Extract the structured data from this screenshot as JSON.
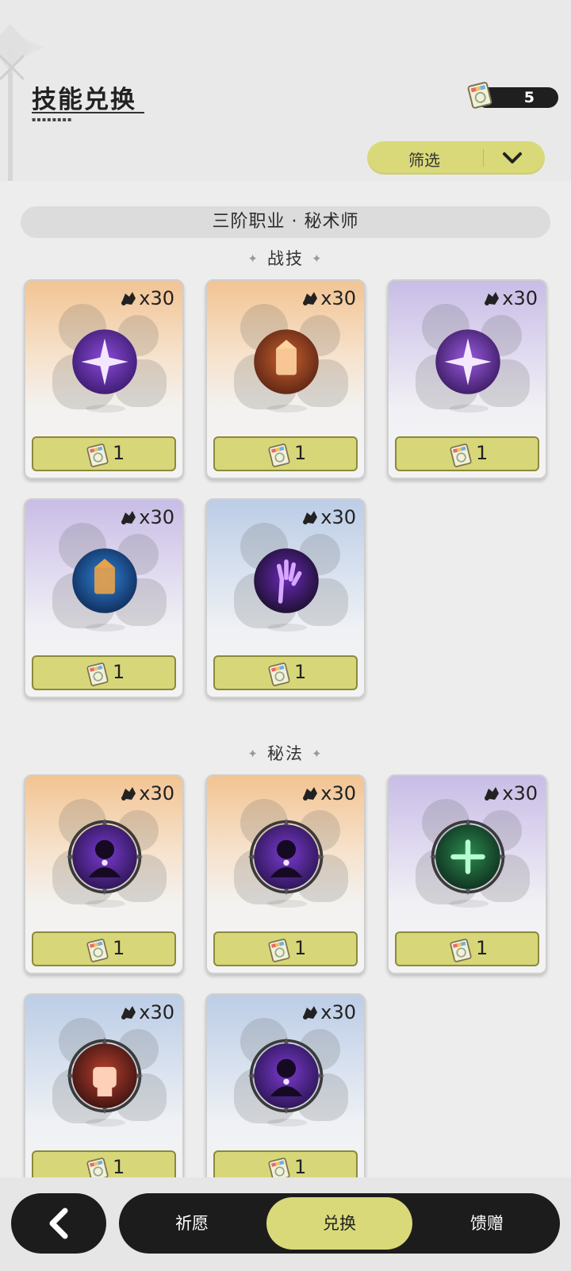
{
  "header": {
    "title": "技能兑换",
    "currency_value": "5",
    "filter_label": "筛选"
  },
  "class_name": "三阶职业 · 秘术师",
  "sections": [
    {
      "title": "战技",
      "cards": [
        {
          "theme": "orange",
          "icon": "purple-star-burst-skill-icon",
          "count": "x30",
          "cost": "1"
        },
        {
          "theme": "orange",
          "icon": "orange-totem-skill-icon",
          "count": "x30",
          "cost": "1"
        },
        {
          "theme": "purple",
          "icon": "violet-shatter-skill-icon",
          "count": "x30",
          "cost": "1"
        },
        {
          "theme": "purple",
          "icon": "blue-flame-totem-skill-icon",
          "count": "x30",
          "cost": "1"
        },
        {
          "theme": "blue",
          "icon": "shadow-hand-skill-icon",
          "count": "x30",
          "cost": "1"
        }
      ]
    },
    {
      "title": "秘法",
      "cards": [
        {
          "theme": "orange",
          "icon": "eye-figure-arcane-icon",
          "count": "x30",
          "cost": "1"
        },
        {
          "theme": "orange",
          "icon": "heart-figure-arcane-icon",
          "count": "x30",
          "cost": "1"
        },
        {
          "theme": "purple",
          "icon": "green-heal-arcane-icon",
          "count": "x30",
          "cost": "1"
        },
        {
          "theme": "blue",
          "icon": "red-fist-arcane-icon",
          "count": "x30",
          "cost": "1"
        },
        {
          "theme": "blue",
          "icon": "power-up-figure-arcane-icon",
          "count": "x30",
          "cost": "1"
        }
      ]
    }
  ],
  "nav": {
    "tabs": [
      "祈愿",
      "兑换",
      "馈赠"
    ],
    "active_tab": "兑换"
  }
}
